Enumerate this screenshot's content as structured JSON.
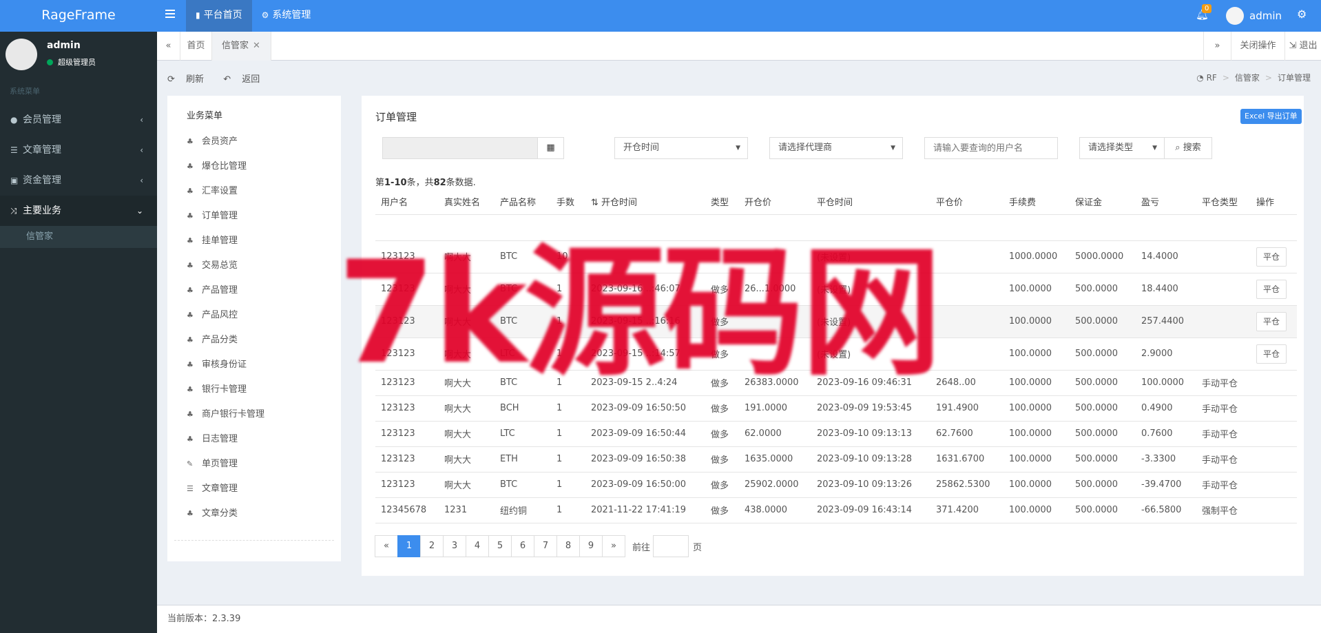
{
  "brand": "RageFrame",
  "topnav": [
    {
      "label": "平台首页",
      "icon": "bookmark-icon",
      "active": true
    },
    {
      "label": "系统管理",
      "icon": "cogs-icon",
      "active": false
    }
  ],
  "topbar": {
    "notif_count": "0",
    "user": "admin"
  },
  "sidebar": {
    "user": "admin",
    "role": "超级管理员",
    "section": "系统菜单",
    "items": [
      {
        "label": "会员管理",
        "icon": "user-icon"
      },
      {
        "label": "文章管理",
        "icon": "list-icon"
      },
      {
        "label": "资金管理",
        "icon": "money-icon"
      },
      {
        "label": "主要业务",
        "icon": "random-icon"
      }
    ],
    "sub_item": "信管家"
  },
  "tabs": {
    "collapse": "«",
    "home": "首页",
    "current": "信管家",
    "expand": "»",
    "close_ops": "关闭操作",
    "logout": "退出"
  },
  "toolbar": {
    "refresh": "刷新",
    "back": "返回"
  },
  "breadcrumb": [
    "RF",
    "信管家",
    "订单管理"
  ],
  "business_menu": {
    "title": "业务菜单",
    "items": [
      "会员资产",
      "爆仓比管理",
      "汇率设置",
      "订单管理",
      "挂单管理",
      "交易总览",
      "产品管理",
      "产品风控",
      "产品分类",
      "审核身份证",
      "银行卡管理",
      "商户银行卡管理",
      "日志管理",
      "单页管理",
      "文章管理",
      "文章分类"
    ]
  },
  "page": {
    "title": "订单管理",
    "export_label": "Excel 导出订单",
    "filters": {
      "open_time_select": "开仓时间",
      "agent_select": "请选择代理商",
      "username_placeholder": "请输入要查询的用户名",
      "type_select": "请选择类型",
      "search_label": "搜索"
    },
    "summary": {
      "prefix": "第",
      "range": "1-10",
      "mid": "条，共",
      "total": "82",
      "suffix": "条数据."
    }
  },
  "table": {
    "headers": [
      "用户名",
      "真实姓名",
      "产品名称",
      "手数",
      "开仓时间",
      "类型",
      "开仓价",
      "平仓时间",
      "平仓价",
      "手续费",
      "保证金",
      "盈亏",
      "平仓类型",
      "操作"
    ],
    "rows": [
      {
        "user": "123123",
        "name": "啊大大",
        "product": "BTC",
        "lots": "10",
        "open_time": "",
        "type": "",
        "open_price": "",
        "close_time": "(未设置)",
        "close_price": "",
        "fee": "1000.0000",
        "margin": "5000.0000",
        "pnl": "14.4000",
        "close_type": "",
        "action": "平仓"
      },
      {
        "user": "123123",
        "name": "啊大大",
        "product": "BTC",
        "lots": "1",
        "open_time": "2023-09-16 ..:46:07",
        "type": "做多",
        "open_price": "26...1.0000",
        "close_time": "(未设置)",
        "close_price": "",
        "fee": "100.0000",
        "margin": "500.0000",
        "pnl": "18.4400",
        "close_type": "",
        "action": "平仓"
      },
      {
        "user": "123123",
        "name": "啊大大",
        "product": "BTC",
        "lots": "1",
        "open_time": "2023-09-15 ..:16:16",
        "type": "做多",
        "open_price": "",
        "close_time": "(未设置)",
        "close_price": "",
        "fee": "100.0000",
        "margin": "500.0000",
        "pnl": "257.4400",
        "close_type": "",
        "action": "平仓"
      },
      {
        "user": "123123",
        "name": "啊大大",
        "product": "LTC",
        "lots": "1",
        "open_time": "2023-09-15 ..:14:57",
        "type": "做多",
        "open_price": "",
        "close_time": "(未设置)",
        "close_price": "",
        "fee": "100.0000",
        "margin": "500.0000",
        "pnl": "2.9000",
        "close_type": "",
        "action": "平仓"
      },
      {
        "user": "123123",
        "name": "啊大大",
        "product": "BTC",
        "lots": "1",
        "open_time": "2023-09-15 2..4:24",
        "type": "做多",
        "open_price": "26383.0000",
        "close_time": "2023-09-16 09:46:31",
        "close_price": "2648..00",
        "fee": "100.0000",
        "margin": "500.0000",
        "pnl": "100.0000",
        "close_type": "手动平仓",
        "action": ""
      },
      {
        "user": "123123",
        "name": "啊大大",
        "product": "BCH",
        "lots": "1",
        "open_time": "2023-09-09 16:50:50",
        "type": "做多",
        "open_price": "191.0000",
        "close_time": "2023-09-09 19:53:45",
        "close_price": "191.4900",
        "fee": "100.0000",
        "margin": "500.0000",
        "pnl": "0.4900",
        "close_type": "手动平仓",
        "action": ""
      },
      {
        "user": "123123",
        "name": "啊大大",
        "product": "LTC",
        "lots": "1",
        "open_time": "2023-09-09 16:50:44",
        "type": "做多",
        "open_price": "62.0000",
        "close_time": "2023-09-10 09:13:13",
        "close_price": "62.7600",
        "fee": "100.0000",
        "margin": "500.0000",
        "pnl": "0.7600",
        "close_type": "手动平仓",
        "action": ""
      },
      {
        "user": "123123",
        "name": "啊大大",
        "product": "ETH",
        "lots": "1",
        "open_time": "2023-09-09 16:50:38",
        "type": "做多",
        "open_price": "1635.0000",
        "close_time": "2023-09-10 09:13:28",
        "close_price": "1631.6700",
        "fee": "100.0000",
        "margin": "500.0000",
        "pnl": "-3.3300",
        "close_type": "手动平仓",
        "action": ""
      },
      {
        "user": "123123",
        "name": "啊大大",
        "product": "BTC",
        "lots": "1",
        "open_time": "2023-09-09 16:50:00",
        "type": "做多",
        "open_price": "25902.0000",
        "close_time": "2023-09-10 09:13:26",
        "close_price": "25862.5300",
        "fee": "100.0000",
        "margin": "500.0000",
        "pnl": "-39.4700",
        "close_type": "手动平仓",
        "action": ""
      },
      {
        "user": "12345678",
        "name": "1231",
        "product": "纽约铜",
        "lots": "1",
        "open_time": "2021-11-22 17:41:19",
        "type": "做多",
        "open_price": "438.0000",
        "close_time": "2023-09-09 16:43:14",
        "close_price": "371.4200",
        "fee": "100.0000",
        "margin": "500.0000",
        "pnl": "-66.5800",
        "close_type": "强制平仓",
        "action": ""
      }
    ]
  },
  "pagination": {
    "prev": "«",
    "pages": [
      "1",
      "2",
      "3",
      "4",
      "5",
      "6",
      "7",
      "8",
      "9"
    ],
    "next": "»",
    "goto_label": "前往",
    "page_label": "页"
  },
  "footer": {
    "version": "当前版本：2.3.39"
  },
  "watermark": "7k源码网",
  "colors": {
    "primary": "#3c8dee",
    "sidebar": "#222d32",
    "badge": "#f39c12",
    "online": "#00a65a",
    "watermark": "#e10028"
  }
}
